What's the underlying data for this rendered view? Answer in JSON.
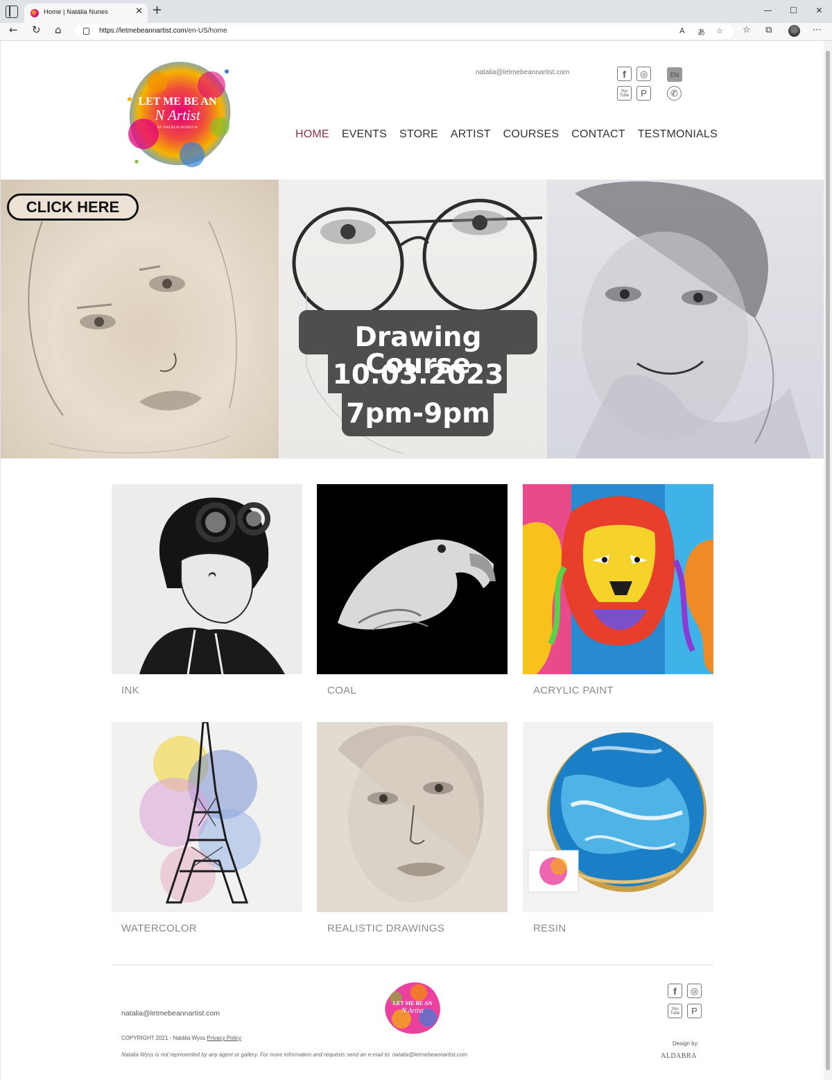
{
  "browser": {
    "tab_title": "Home | Natália Nunes",
    "tab_close": "✕",
    "new_tab": "+",
    "url_host": "https://letmebeannartist.com",
    "url_path": "/en-US/home",
    "window_controls": [
      "—",
      "☐",
      "✕"
    ]
  },
  "header": {
    "email": "natalia@letmebeannartist.com",
    "language": "EN",
    "social": [
      {
        "icon": "facebook-icon",
        "glyph": "f"
      },
      {
        "icon": "instagram-icon",
        "glyph": "◎"
      },
      {
        "icon": "whatsapp-icon",
        "glyph": "✆"
      },
      {
        "icon": "youtube-icon",
        "glyph": "You Tube"
      },
      {
        "icon": "pinterest-icon",
        "glyph": "P"
      }
    ],
    "logo": {
      "line1": "LET ME BE AN",
      "line2": "N Artist",
      "line3": "BY NATÁLIA NUNES W"
    }
  },
  "nav": {
    "items": [
      "HOME",
      "EVENTS",
      "STORE",
      "ARTIST",
      "COURSES",
      "CONTACT",
      "TESTMONIALS"
    ],
    "active": "HOME",
    "active_color": "#8e2f52"
  },
  "hero": {
    "click_here": "CLICK HERE",
    "course_title": "Drawing Course",
    "course_date": "10.03.2023",
    "course_time": "7pm-9pm"
  },
  "gallery": {
    "items": [
      {
        "label": "INK"
      },
      {
        "label": "COAL"
      },
      {
        "label": "ACRYLIC PAINT"
      },
      {
        "label": "WATERCOLOR"
      },
      {
        "label": "REALISTIC DRAWINGS"
      },
      {
        "label": "RESIN"
      }
    ]
  },
  "footer": {
    "email": "natalia@letmebeannartist.com",
    "copyright": "COPYRIGHT 2021 - Natália Wyss",
    "privacy_policy": "Privacy Policy",
    "note": "Natalia Wyss is not represented by any agent or gallery. For more information and requests send an e-mail to: natalia@letmebeannartist.com",
    "design_by": "Design by:",
    "designer": "ALDABRA"
  }
}
